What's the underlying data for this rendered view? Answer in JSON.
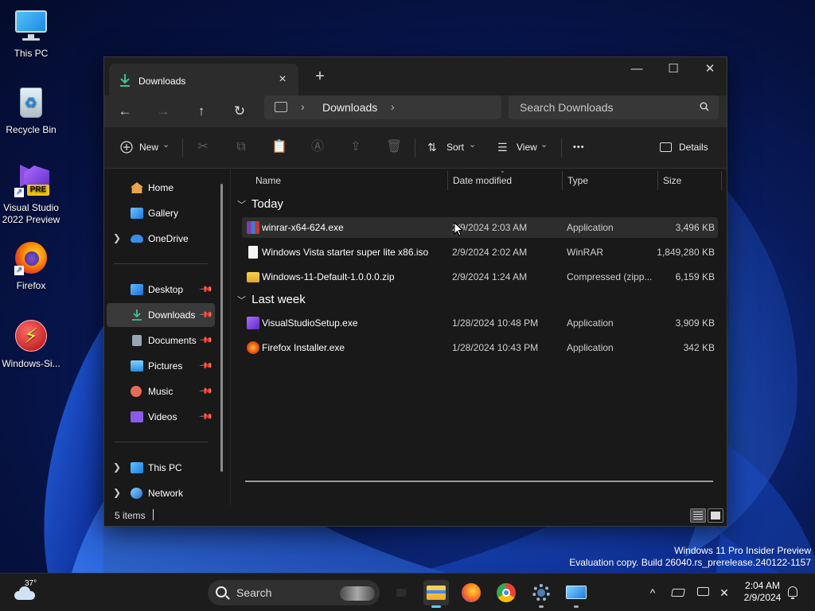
{
  "desktop": {
    "icons": [
      {
        "label": "This PC"
      },
      {
        "label": "Recycle Bin"
      },
      {
        "label": "Visual Studio 2022 Preview",
        "badge": "PRE"
      },
      {
        "label": "Firefox"
      },
      {
        "label": "Windows-Si..."
      }
    ]
  },
  "window": {
    "tab_title": "Downloads",
    "tab_close": "×",
    "new_tab": "+",
    "controls": {
      "minimize": "—",
      "maximize": "☐",
      "close": "✕"
    },
    "nav": {
      "back": "←",
      "forward": "→",
      "up": "↑",
      "refresh": "↻"
    },
    "address": {
      "separator": "›",
      "crumb": "Downloads"
    },
    "search_placeholder": "Search Downloads",
    "toolbar": {
      "new_label": "New",
      "sort_label": "Sort",
      "view_label": "View",
      "more_label": "•••",
      "details_label": "Details",
      "dropdown_glyph": "⌄"
    },
    "sidebar": [
      {
        "label": "Home",
        "icon": "home-icon",
        "color": "#e8a44d"
      },
      {
        "label": "Gallery",
        "icon": "gallery-icon",
        "color": "#3aa0e8"
      },
      {
        "label": "OneDrive",
        "icon": "onedrive-icon",
        "color": "#3a8ee8",
        "expandable": true
      },
      {
        "label": "Desktop",
        "icon": "desktop-icon",
        "color": "#3b9ff0",
        "pinned": true
      },
      {
        "label": "Downloads",
        "icon": "downloads-icon",
        "color": "#3fc28c",
        "pinned": true,
        "selected": true
      },
      {
        "label": "Documents",
        "icon": "documents-icon",
        "color": "#9aa5b4",
        "pinned": true
      },
      {
        "label": "Pictures",
        "icon": "pictures-icon",
        "color": "#3aa0e8",
        "pinned": true
      },
      {
        "label": "Music",
        "icon": "music-icon",
        "color": "#e86a5a",
        "pinned": true
      },
      {
        "label": "Videos",
        "icon": "videos-icon",
        "color": "#8a5ae8",
        "pinned": true
      },
      {
        "label": "This PC",
        "icon": "this-pc-icon",
        "color": "#3aa0e8",
        "expandable": true
      },
      {
        "label": "Network",
        "icon": "network-icon",
        "color": "#3aa0e8",
        "expandable": true
      }
    ],
    "columns": {
      "name": "Name",
      "date": "Date modified",
      "type": "Type",
      "size": "Size"
    },
    "groups": [
      {
        "label": "Today",
        "files": [
          {
            "name": "winrar-x64-624.exe",
            "date": "2/9/2024 2:03 AM",
            "type": "Application",
            "size": "3,496 KB",
            "icon": "winrar-icon"
          },
          {
            "name": "Windows Vista starter super lite x86.iso",
            "date": "2/9/2024 2:02 AM",
            "type": "WinRAR",
            "size": "1,849,280 KB",
            "icon": "iso-file-icon"
          },
          {
            "name": "Windows-11-Default-1.0.0.0.zip",
            "date": "2/9/2024 1:24 AM",
            "type": "Compressed (zipp...",
            "size": "6,159 KB",
            "icon": "zip-folder-icon"
          }
        ]
      },
      {
        "label": "Last week",
        "files": [
          {
            "name": "VisualStudioSetup.exe",
            "date": "1/28/2024 10:48 PM",
            "type": "Application",
            "size": "3,909 KB",
            "icon": "visual-studio-icon"
          },
          {
            "name": "Firefox Installer.exe",
            "date": "1/28/2024 10:43 PM",
            "type": "Application",
            "size": "342 KB",
            "icon": "firefox-installer-icon"
          }
        ]
      }
    ],
    "status": {
      "item_count": "5 items"
    }
  },
  "watermark": {
    "line1": "Windows 11 Pro Insider Preview",
    "line2": "Evaluation copy. Build 26040.rs_prerelease.240122-1157"
  },
  "taskbar": {
    "weather_temp": "37°",
    "search_label": "Search",
    "clock_time": "2:04 AM",
    "clock_date": "2/9/2024",
    "tray_chevron": "^"
  }
}
